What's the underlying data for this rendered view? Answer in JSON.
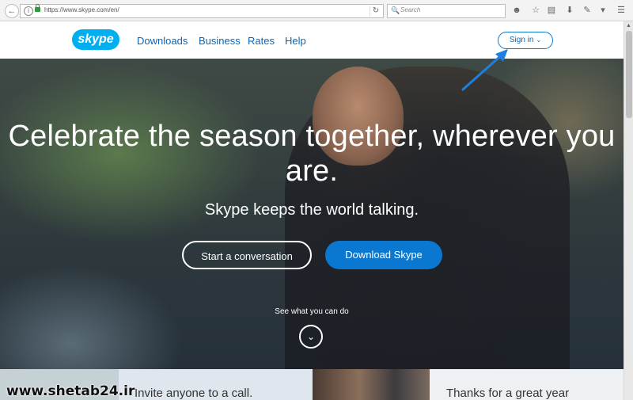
{
  "browser": {
    "url": "https://www.skype.com/en/",
    "search_placeholder": "Search"
  },
  "nav": {
    "logo": "skype",
    "links": [
      "Downloads",
      "Business",
      "Rates",
      "Help"
    ],
    "signin_label": "Sign in"
  },
  "hero": {
    "title": "Celebrate the season together, wherever you are.",
    "subtitle": "Skype keeps the world talking.",
    "btn_start": "Start a conversation",
    "btn_download": "Download Skype",
    "see_what": "See what you can do"
  },
  "bottom": {
    "card1": "Invite anyone to a call.",
    "card2": "Thanks for a great year"
  },
  "watermark": "www.shetab24.ir",
  "colors": {
    "brand_blue": "#0a78d1",
    "skype_logo": "#00aff0",
    "annotation_arrow": "#1e7fe0"
  }
}
